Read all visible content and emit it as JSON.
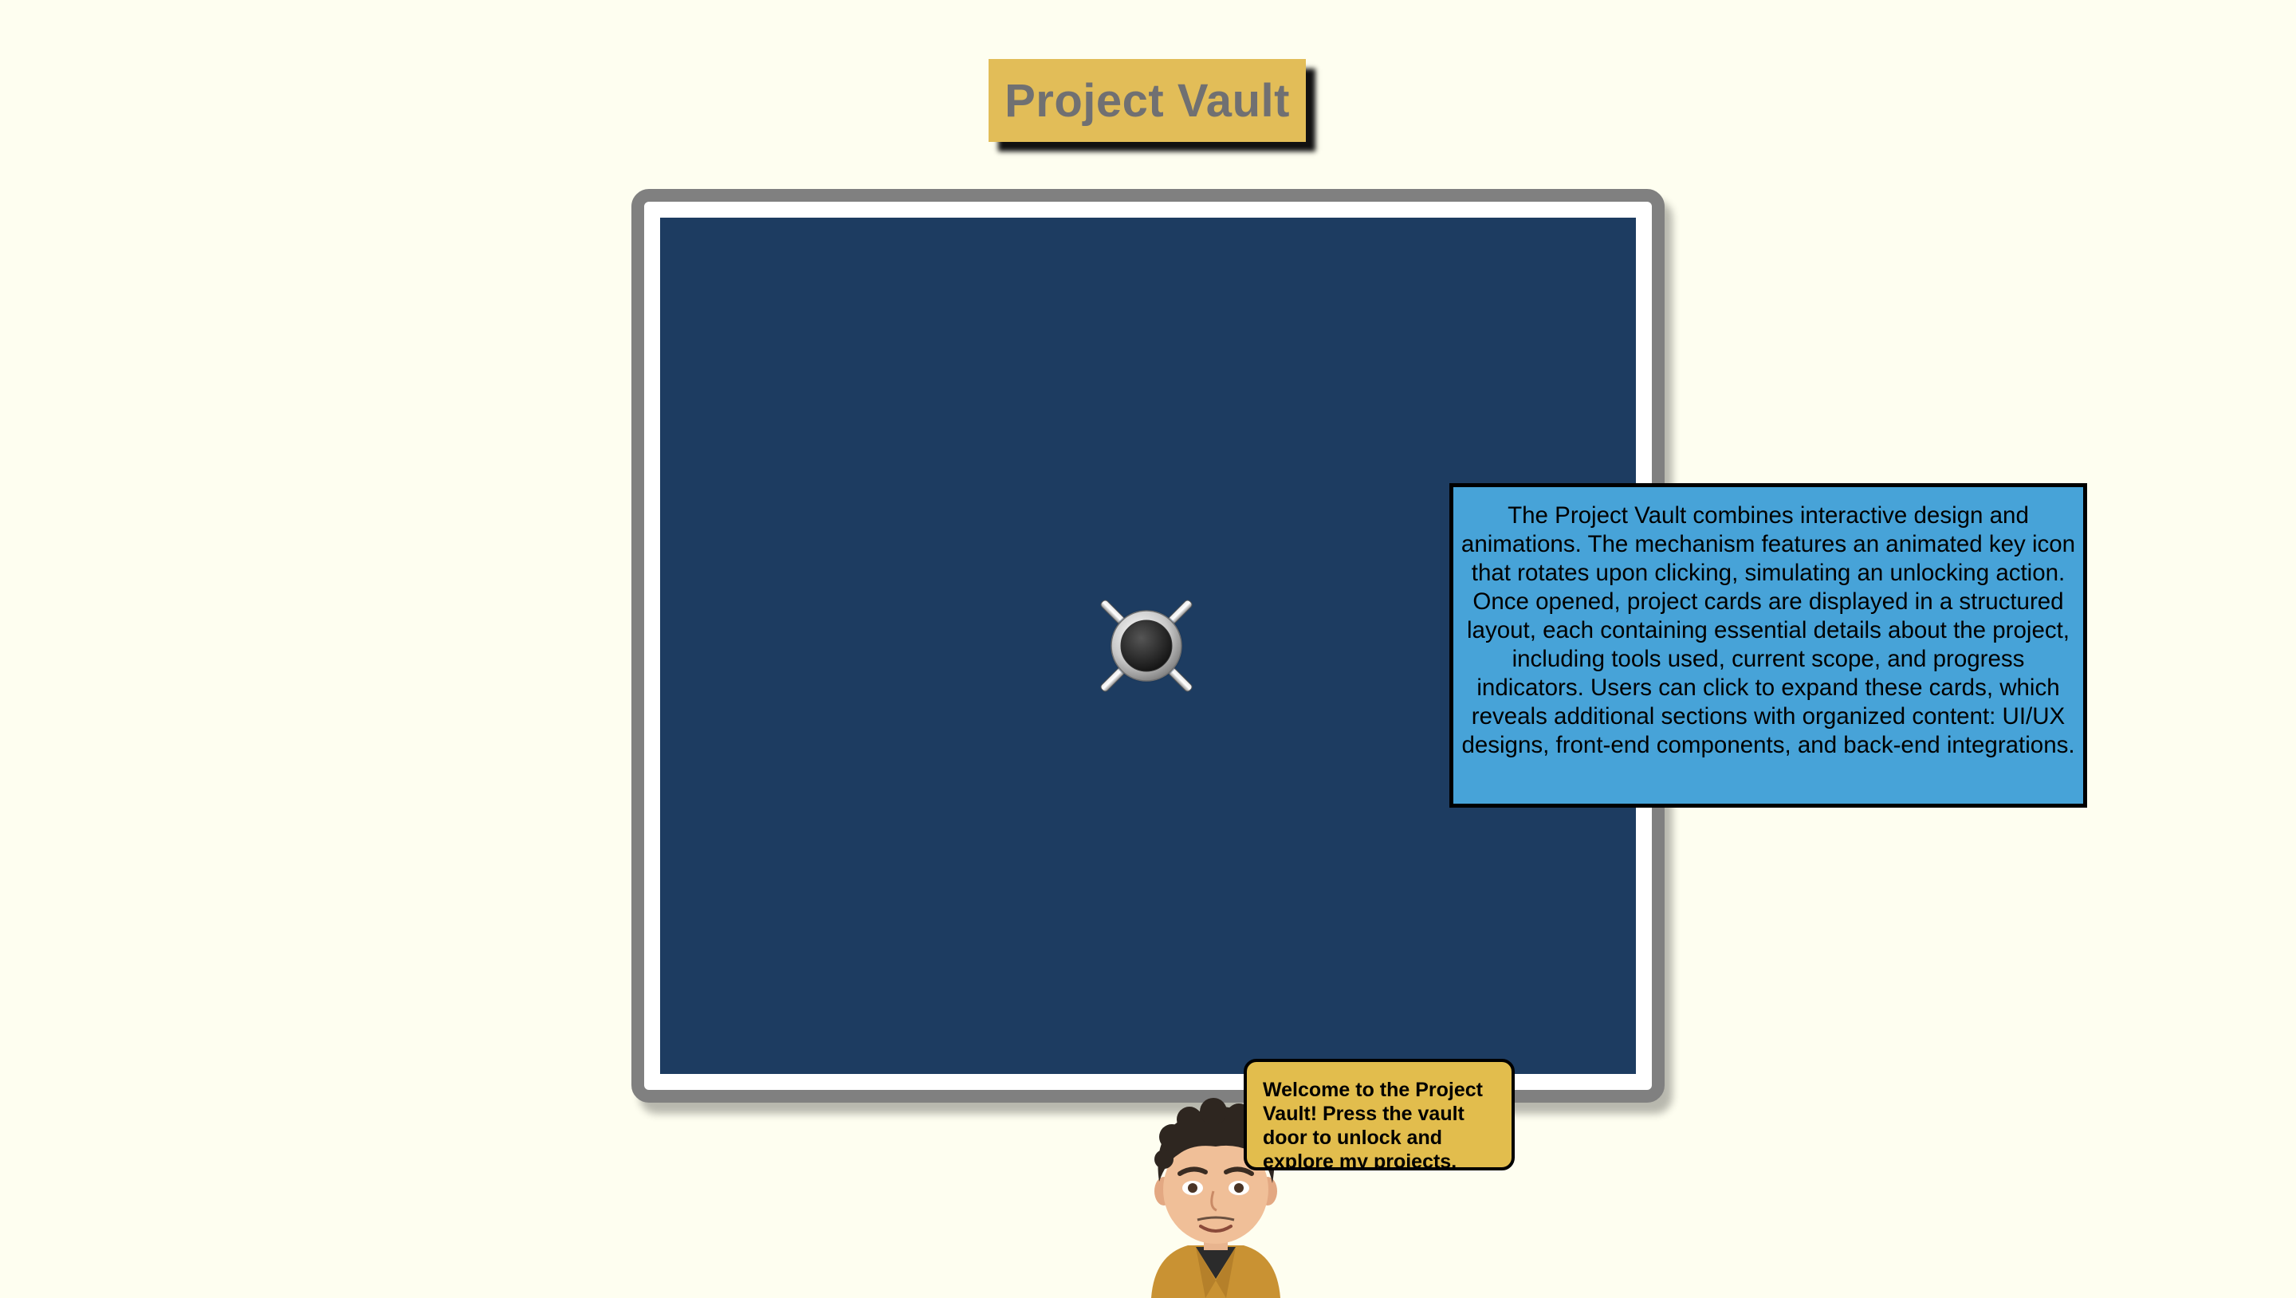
{
  "header": {
    "title": "Project Vault"
  },
  "vault": {
    "door_color": "#1d3c61",
    "frame_color": "#808080",
    "handle_icon": "vault-dial-icon"
  },
  "info": {
    "text": "The Project Vault combines interactive design and animations. The mechanism features an animated key icon that rotates upon clicking, simulating an unlocking action. Once opened, project cards are displayed in a structured layout, each containing essential details about the project, including tools used, current scope, and progress indicators. Users can click to expand these cards, which reveals additional sections with organized content: UI/UX designs, front-end components, and back-end integrations."
  },
  "guide": {
    "message": "Welcome to the Project Vault! Press the vault door to unlock and explore my projects.",
    "avatar_icon": "avatar-icon"
  },
  "colors": {
    "background": "#fefef0",
    "title_bg": "#e2bd58",
    "title_text": "#707072",
    "info_bg": "#47a3d8",
    "bubble_bg": "#e2bd4d"
  }
}
